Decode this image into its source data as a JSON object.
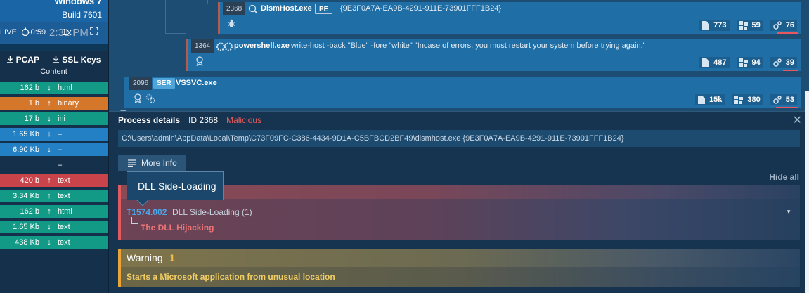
{
  "left_panel": {
    "os_name": "Windows 7",
    "os_build": "Build 7601",
    "controls": {
      "live": "LIVE",
      "time": "-0:59",
      "clock": "2:31 PM",
      "speed": "1x"
    },
    "pcap_label": "PCAP",
    "ssl_keys_label": "SSL Keys",
    "content_header": "Content",
    "connections": [
      {
        "size": "162 b",
        "dir": "↓",
        "type": "html",
        "color": "teal"
      },
      {
        "size": "1 b",
        "dir": "↑",
        "type": "binary",
        "color": "orange"
      },
      {
        "size": "17 b",
        "dir": "↓",
        "type": "ini",
        "color": "teal"
      },
      {
        "size": "1.65 Kb",
        "dir": "↓",
        "type": "–",
        "color": "blue"
      },
      {
        "size": "6.90 Kb",
        "dir": "↓",
        "type": "–",
        "color": "blue"
      },
      {
        "size": "",
        "dir": "",
        "type": "–",
        "color": "none"
      },
      {
        "size": "420 b",
        "dir": "↑",
        "type": "text",
        "color": "red"
      },
      {
        "size": "3.34 Kb",
        "dir": "↑",
        "type": "text",
        "color": "teal"
      },
      {
        "size": "162 b",
        "dir": "↑",
        "type": "html",
        "color": "teal"
      },
      {
        "size": "1.65 Kb",
        "dir": "↓",
        "type": "text",
        "color": "teal"
      },
      {
        "size": "438 Kb",
        "dir": "↓",
        "type": "text",
        "color": "teal"
      }
    ]
  },
  "process_tree": {
    "dismhost": {
      "pid": "2368",
      "name": "DismHost.exe",
      "tag": "PE",
      "cmd": "{9E3F0A7A-EA9B-4291-911E-73901FFF1B24}",
      "stats": {
        "files": "773",
        "registry": "59",
        "modules": "76"
      }
    },
    "powershell": {
      "pid": "1364",
      "name": "powershell.exe",
      "cmd": "write-host -back \"Blue\" -fore \"white\" \"Incase of errors, you must restart your system before trying again.\"",
      "stats": {
        "files": "487",
        "registry": "94",
        "modules": "39"
      }
    },
    "vssvc": {
      "pid": "2096",
      "tag": "SER",
      "name": "VSSVC.exe",
      "stats": {
        "files": "15k",
        "registry": "380",
        "modules": "53"
      }
    }
  },
  "details": {
    "title": "Process details",
    "id_label": "ID 2368",
    "verdict": "Malicious",
    "command_line": "C:\\Users\\admin\\AppData\\Local\\Temp\\C73F09FC-C386-4434-9D1A-C5BFBCD2BF49\\dismhost.exe {9E3F0A7A-EA9B-4291-911E-73901FFF1B24}",
    "more_info": "More Info",
    "hide_all": "Hide all",
    "tooltip": "DLL Side-Loading",
    "technique_id": "T1574.002",
    "technique_name": "DLL Side-Loading (1)",
    "sub_technique": "The DLL Hijacking",
    "warning_title": "Warning",
    "warning_count": "1",
    "warning_text": "Starts a Microsoft application from unusual location"
  },
  "colors": {
    "danger": "#e05a5f",
    "warning": "#e9a43a",
    "malicious": "#ef5d5d",
    "link": "#4aa7ea"
  }
}
